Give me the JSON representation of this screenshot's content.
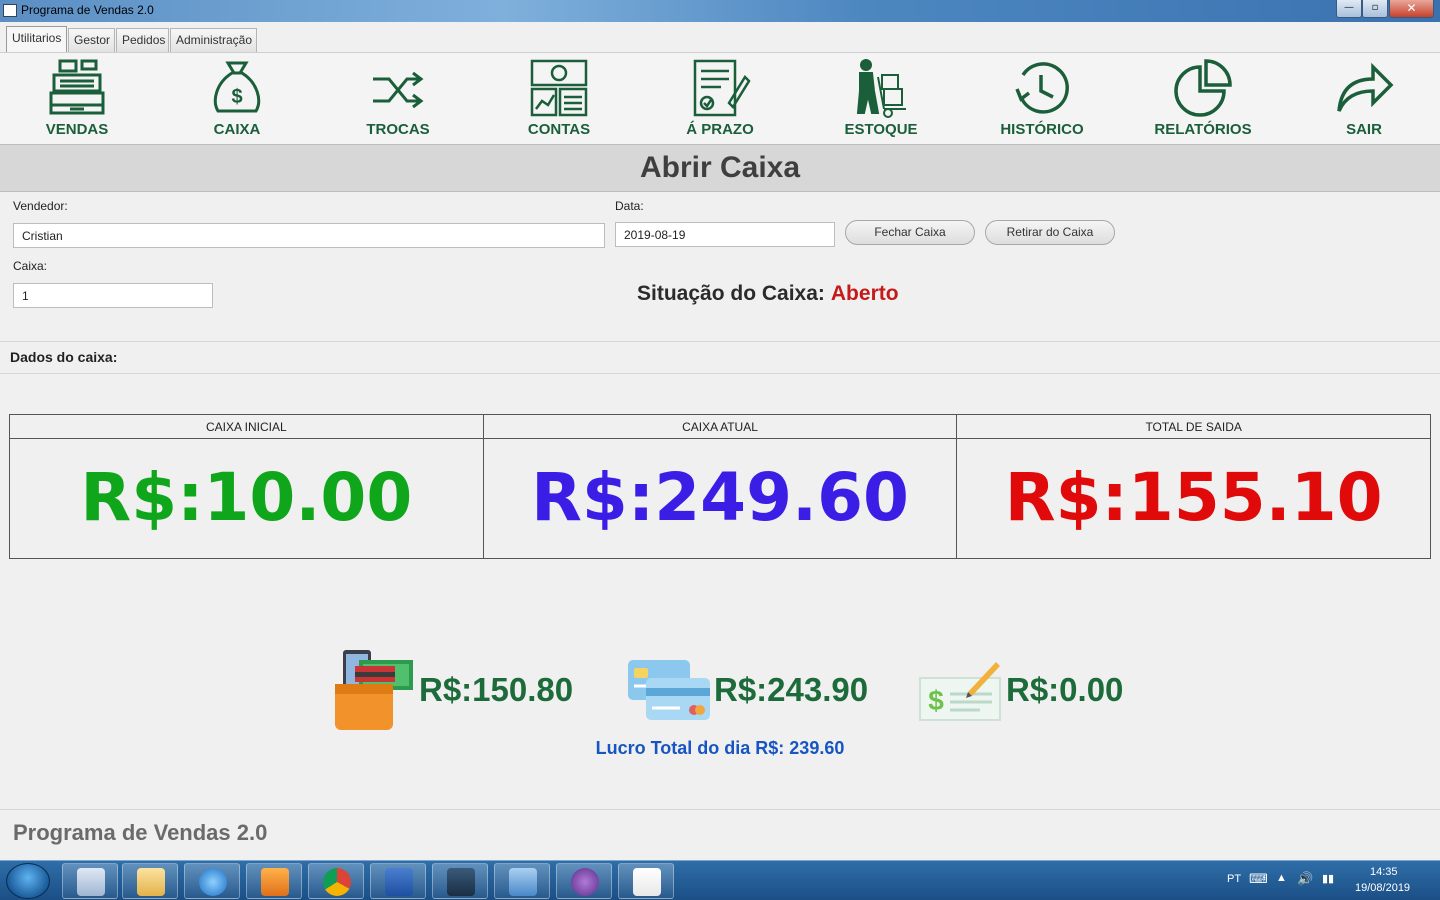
{
  "window": {
    "title": "Programa de Vendas 2.0",
    "minimize": "—",
    "maximize": "▫",
    "close": "✕"
  },
  "tabs": [
    {
      "label": "Utilitarios",
      "active": true
    },
    {
      "label": "Gestor"
    },
    {
      "label": "Pedidos"
    },
    {
      "label": "Administração"
    }
  ],
  "toolbar": {
    "items": [
      {
        "label": "VENDAS",
        "icon": "cash-register-icon"
      },
      {
        "label": "CAIXA",
        "icon": "money-bag-icon"
      },
      {
        "label": "TROCAS",
        "icon": "exchange-arrows-icon"
      },
      {
        "label": "CONTAS",
        "icon": "accounts-calculator-icon"
      },
      {
        "label": "Á PRAZO",
        "icon": "contract-signature-icon"
      },
      {
        "label": "ESTOQUE",
        "icon": "hand-truck-icon"
      },
      {
        "label": "HISTÓRICO",
        "icon": "history-clock-icon"
      },
      {
        "label": "RELATÓRIOS",
        "icon": "pie-chart-icon"
      },
      {
        "label": "SAIR",
        "icon": "exit-arrow-icon"
      }
    ],
    "color": "#1b5e3a"
  },
  "header": {
    "title": "Abrir Caixa"
  },
  "form": {
    "vendedor_label": "Vendedor:",
    "vendedor_value": "Cristian",
    "data_label": "Data:",
    "data_value": "2019-08-19",
    "caixa_label": "Caixa:",
    "caixa_value": "1",
    "fechar_button": "Fechar Caixa",
    "retirar_button": "Retirar do Caixa"
  },
  "situacao": {
    "label": "Situação do Caixa:",
    "value": "Aberto",
    "color": "#c51a1a"
  },
  "dados_label": "Dados do caixa:",
  "totals": [
    {
      "header": "CAIXA INICIAL",
      "value": "R$:10.00",
      "color": "#10a61c"
    },
    {
      "header": "CAIXA  ATUAL",
      "value": "R$:249.60",
      "color": "#3a1ee6"
    },
    {
      "header": "TOTAL DE SAIDA",
      "value": "R$:155.10",
      "color": "#e00a0a"
    }
  ],
  "payments": [
    {
      "icon": "wallet-icon",
      "value": "R$:150.80"
    },
    {
      "icon": "credit-cards-icon",
      "value": "R$:243.90"
    },
    {
      "icon": "check-icon",
      "value": "R$:0.00"
    }
  ],
  "lucro": "Lucro Total do dia R$: 239.60",
  "footer": "Programa de Vendas 2.0",
  "taskbar": {
    "apps": [
      "folder-icon",
      "file-manager-icon",
      "internet-explorer-icon",
      "media-player-icon",
      "chrome-icon",
      "word-icon",
      "mysql-workbench-icon",
      "virtualbox-icon",
      "github-icon",
      "java-icon"
    ],
    "language": "PT",
    "time": "14:35",
    "date": "19/08/2019"
  }
}
